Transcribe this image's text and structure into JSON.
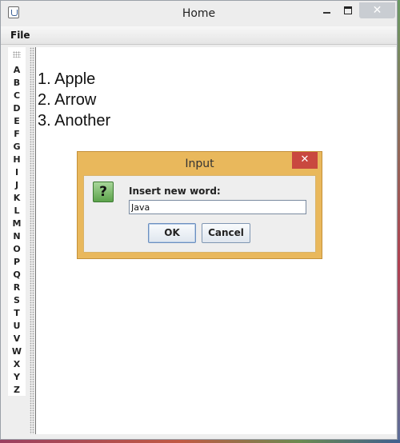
{
  "window": {
    "title": "Home",
    "app_icon": "java-icon",
    "controls": {
      "minimize": "minimize-icon",
      "maximize": "maximize-icon",
      "close": "close-icon"
    }
  },
  "menubar": {
    "items": [
      "File"
    ]
  },
  "alphabet": [
    "A",
    "B",
    "C",
    "D",
    "E",
    "F",
    "G",
    "H",
    "I",
    "J",
    "K",
    "L",
    "M",
    "N",
    "O",
    "P",
    "Q",
    "R",
    "S",
    "T",
    "U",
    "V",
    "W",
    "X",
    "Y",
    "Z"
  ],
  "words": [
    "1. Apple",
    "2. Arrow",
    "3. Another"
  ],
  "dialog": {
    "title": "Input",
    "close_glyph": "✕",
    "icon_glyph": "?",
    "prompt": "Insert new word:",
    "input_value": "Java",
    "ok_label": "OK",
    "cancel_label": "Cancel",
    "colors": {
      "frame": "#e9b85c",
      "close": "#c9483f",
      "question_icon": "#6db35a"
    }
  }
}
